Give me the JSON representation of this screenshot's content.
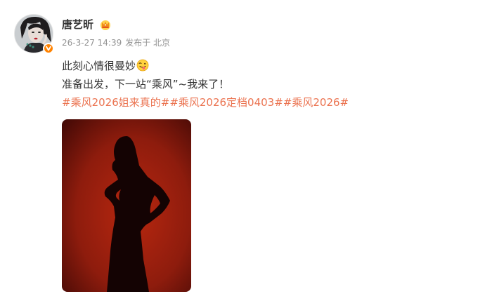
{
  "author": {
    "name": "唐艺昕"
  },
  "meta": {
    "timestamp": "26-3-27 14:39",
    "location": "发布于 北京"
  },
  "post": {
    "line1": "此刻心情很曼妙",
    "line2": "准备出发，下一站“乘风”~我来了！",
    "hashtags": [
      "#乘风2026姐来真的#",
      "#乘风2026定档0403#",
      "#乘风2026#"
    ]
  },
  "colors": {
    "text": "#333333",
    "meta": "#939393",
    "hashtag": "#eb7350",
    "verified_badge": "#ff8200",
    "photo_background": "#9c2010"
  },
  "icons": {
    "verified": "verified-v-icon",
    "vip": "crown-icon",
    "emoji": "tongue-emoji-icon"
  }
}
